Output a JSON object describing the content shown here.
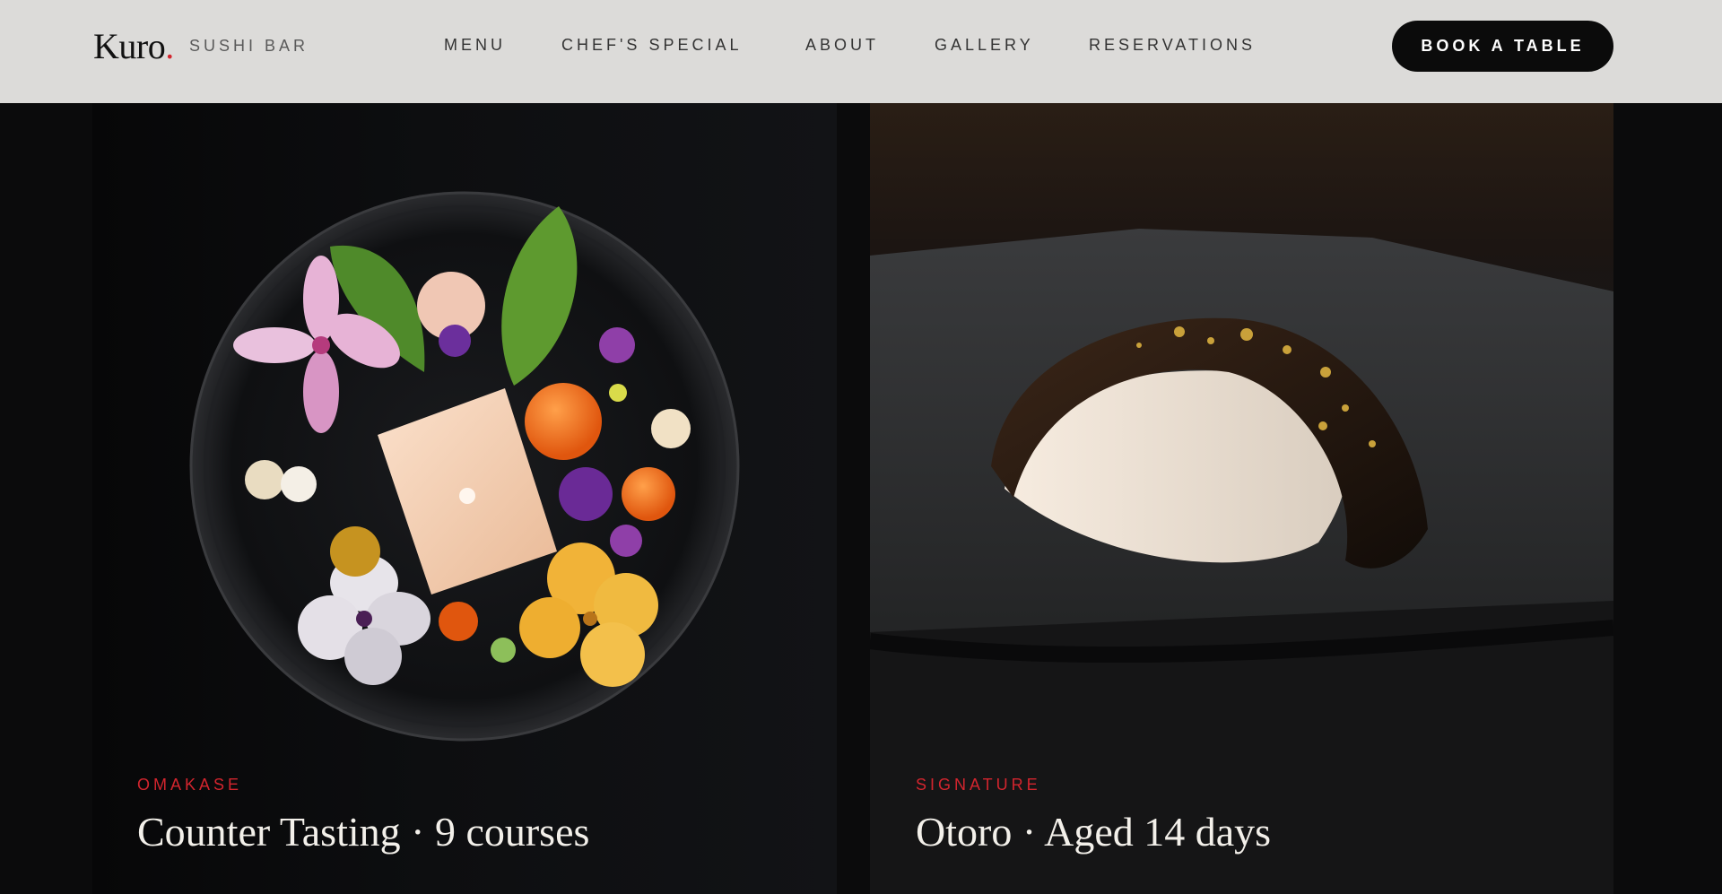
{
  "brand": {
    "name": "Kuro",
    "dot": ".",
    "subtitle": "SUSHI BAR"
  },
  "nav": {
    "items": [
      {
        "label": "MENU"
      },
      {
        "label": "CHEF'S SPECIAL"
      },
      {
        "label": "ABOUT"
      },
      {
        "label": "GALLERY"
      },
      {
        "label": "RESERVATIONS"
      }
    ],
    "cta_label": "BOOK A TABLE"
  },
  "cards": [
    {
      "eyebrow": "OMAKASE",
      "title": "Counter Tasting · 9 courses"
    },
    {
      "eyebrow": "SIGNATURE",
      "title": "Otoro · Aged 14 days"
    }
  ],
  "colors": {
    "accent": "#d3252e",
    "header_bg": "#dcdbd9",
    "page_bg": "#0b0b0c",
    "cta_bg": "#0b0b0b"
  }
}
